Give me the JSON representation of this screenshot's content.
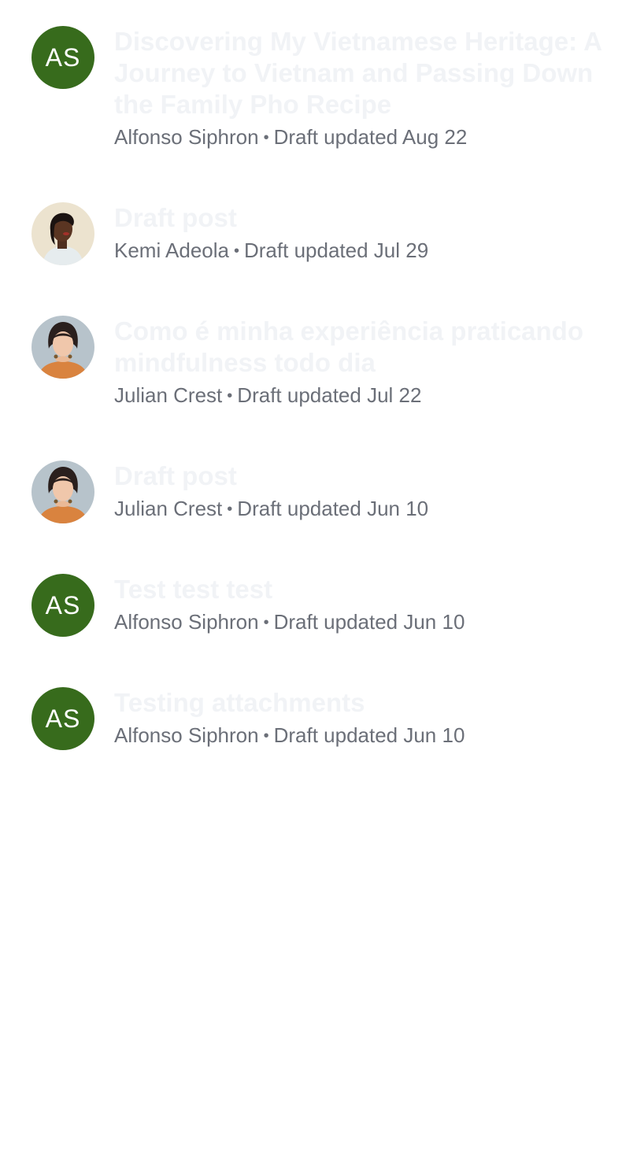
{
  "drafts": [
    {
      "title": "Discovering My Vietnamese Heritage: A Journey to Vietnam and Passing Down the Family Pho Recipe",
      "author": "Alfonso Siphron",
      "separator": "•",
      "status": "Draft updated Aug 22",
      "avatar": {
        "type": "initials",
        "initials": "AS",
        "color": "#376b1c"
      }
    },
    {
      "title": "Draft post",
      "author": "Kemi Adeola",
      "separator": "•",
      "status": "Draft updated Jul 29",
      "avatar": {
        "type": "photo",
        "icon": "avatar-photo-kemi"
      }
    },
    {
      "title": "Como é minha experiência praticando mindfulness todo dia",
      "author": "Julian Crest",
      "separator": "•",
      "status": "Draft updated Jul 22",
      "avatar": {
        "type": "photo",
        "icon": "avatar-photo-julian"
      }
    },
    {
      "title": "Draft post",
      "author": "Julian Crest",
      "separator": "•",
      "status": "Draft updated Jun 10",
      "avatar": {
        "type": "photo",
        "icon": "avatar-photo-julian"
      }
    },
    {
      "title": "Test test test",
      "author": "Alfonso Siphron",
      "separator": "•",
      "status": "Draft updated Jun 10",
      "avatar": {
        "type": "initials",
        "initials": "AS",
        "color": "#376b1c"
      }
    },
    {
      "title": "Testing attachments",
      "author": "Alfonso Siphron",
      "separator": "•",
      "status": "Draft updated Jun 10",
      "avatar": {
        "type": "initials",
        "initials": "AS",
        "color": "#376b1c"
      }
    }
  ]
}
